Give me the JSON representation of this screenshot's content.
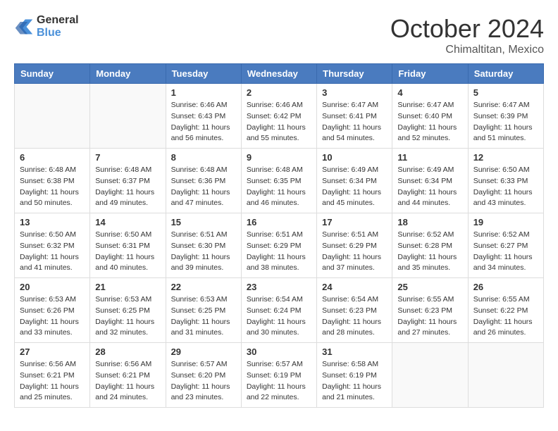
{
  "header": {
    "logo_line1": "General",
    "logo_line2": "Blue",
    "month": "October 2024",
    "location": "Chimaltitan, Mexico"
  },
  "weekdays": [
    "Sunday",
    "Monday",
    "Tuesday",
    "Wednesday",
    "Thursday",
    "Friday",
    "Saturday"
  ],
  "weeks": [
    [
      {
        "day": "",
        "info": ""
      },
      {
        "day": "",
        "info": ""
      },
      {
        "day": "1",
        "info": "Sunrise: 6:46 AM\nSunset: 6:43 PM\nDaylight: 11 hours and 56 minutes."
      },
      {
        "day": "2",
        "info": "Sunrise: 6:46 AM\nSunset: 6:42 PM\nDaylight: 11 hours and 55 minutes."
      },
      {
        "day": "3",
        "info": "Sunrise: 6:47 AM\nSunset: 6:41 PM\nDaylight: 11 hours and 54 minutes."
      },
      {
        "day": "4",
        "info": "Sunrise: 6:47 AM\nSunset: 6:40 PM\nDaylight: 11 hours and 52 minutes."
      },
      {
        "day": "5",
        "info": "Sunrise: 6:47 AM\nSunset: 6:39 PM\nDaylight: 11 hours and 51 minutes."
      }
    ],
    [
      {
        "day": "6",
        "info": "Sunrise: 6:48 AM\nSunset: 6:38 PM\nDaylight: 11 hours and 50 minutes."
      },
      {
        "day": "7",
        "info": "Sunrise: 6:48 AM\nSunset: 6:37 PM\nDaylight: 11 hours and 49 minutes."
      },
      {
        "day": "8",
        "info": "Sunrise: 6:48 AM\nSunset: 6:36 PM\nDaylight: 11 hours and 47 minutes."
      },
      {
        "day": "9",
        "info": "Sunrise: 6:48 AM\nSunset: 6:35 PM\nDaylight: 11 hours and 46 minutes."
      },
      {
        "day": "10",
        "info": "Sunrise: 6:49 AM\nSunset: 6:34 PM\nDaylight: 11 hours and 45 minutes."
      },
      {
        "day": "11",
        "info": "Sunrise: 6:49 AM\nSunset: 6:34 PM\nDaylight: 11 hours and 44 minutes."
      },
      {
        "day": "12",
        "info": "Sunrise: 6:50 AM\nSunset: 6:33 PM\nDaylight: 11 hours and 43 minutes."
      }
    ],
    [
      {
        "day": "13",
        "info": "Sunrise: 6:50 AM\nSunset: 6:32 PM\nDaylight: 11 hours and 41 minutes."
      },
      {
        "day": "14",
        "info": "Sunrise: 6:50 AM\nSunset: 6:31 PM\nDaylight: 11 hours and 40 minutes."
      },
      {
        "day": "15",
        "info": "Sunrise: 6:51 AM\nSunset: 6:30 PM\nDaylight: 11 hours and 39 minutes."
      },
      {
        "day": "16",
        "info": "Sunrise: 6:51 AM\nSunset: 6:29 PM\nDaylight: 11 hours and 38 minutes."
      },
      {
        "day": "17",
        "info": "Sunrise: 6:51 AM\nSunset: 6:29 PM\nDaylight: 11 hours and 37 minutes."
      },
      {
        "day": "18",
        "info": "Sunrise: 6:52 AM\nSunset: 6:28 PM\nDaylight: 11 hours and 35 minutes."
      },
      {
        "day": "19",
        "info": "Sunrise: 6:52 AM\nSunset: 6:27 PM\nDaylight: 11 hours and 34 minutes."
      }
    ],
    [
      {
        "day": "20",
        "info": "Sunrise: 6:53 AM\nSunset: 6:26 PM\nDaylight: 11 hours and 33 minutes."
      },
      {
        "day": "21",
        "info": "Sunrise: 6:53 AM\nSunset: 6:25 PM\nDaylight: 11 hours and 32 minutes."
      },
      {
        "day": "22",
        "info": "Sunrise: 6:53 AM\nSunset: 6:25 PM\nDaylight: 11 hours and 31 minutes."
      },
      {
        "day": "23",
        "info": "Sunrise: 6:54 AM\nSunset: 6:24 PM\nDaylight: 11 hours and 30 minutes."
      },
      {
        "day": "24",
        "info": "Sunrise: 6:54 AM\nSunset: 6:23 PM\nDaylight: 11 hours and 28 minutes."
      },
      {
        "day": "25",
        "info": "Sunrise: 6:55 AM\nSunset: 6:23 PM\nDaylight: 11 hours and 27 minutes."
      },
      {
        "day": "26",
        "info": "Sunrise: 6:55 AM\nSunset: 6:22 PM\nDaylight: 11 hours and 26 minutes."
      }
    ],
    [
      {
        "day": "27",
        "info": "Sunrise: 6:56 AM\nSunset: 6:21 PM\nDaylight: 11 hours and 25 minutes."
      },
      {
        "day": "28",
        "info": "Sunrise: 6:56 AM\nSunset: 6:21 PM\nDaylight: 11 hours and 24 minutes."
      },
      {
        "day": "29",
        "info": "Sunrise: 6:57 AM\nSunset: 6:20 PM\nDaylight: 11 hours and 23 minutes."
      },
      {
        "day": "30",
        "info": "Sunrise: 6:57 AM\nSunset: 6:19 PM\nDaylight: 11 hours and 22 minutes."
      },
      {
        "day": "31",
        "info": "Sunrise: 6:58 AM\nSunset: 6:19 PM\nDaylight: 11 hours and 21 minutes."
      },
      {
        "day": "",
        "info": ""
      },
      {
        "day": "",
        "info": ""
      }
    ]
  ]
}
